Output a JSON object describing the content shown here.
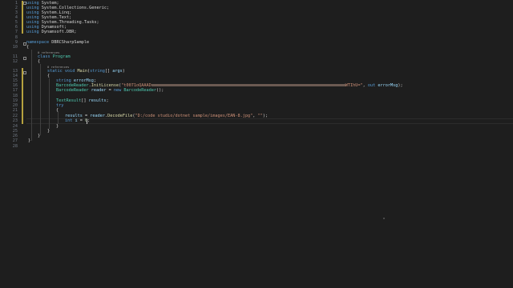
{
  "editor": {
    "line_numbers": [
      "1",
      "2",
      "3",
      "4",
      "5",
      "6",
      "7",
      "8",
      "9",
      "10",
      "11",
      "12",
      "13",
      "14",
      "15",
      "16",
      "17",
      "18",
      "19",
      "20",
      "21",
      "22",
      "23",
      "24",
      "25",
      "26",
      "27",
      "28"
    ],
    "codelens": {
      "class_refs": "0 references",
      "main_refs": "0 references"
    },
    "lines": {
      "l1": {
        "kw": "using",
        "rest": " System;"
      },
      "l2": {
        "kw": "using",
        "rest": " System.Collections.Generic;"
      },
      "l3": {
        "kw": "using",
        "rest": " System.Linq;"
      },
      "l4": {
        "kw": "using",
        "rest": " System.Text;"
      },
      "l5": {
        "kw": "using",
        "rest": " System.Threading.Tasks;"
      },
      "l6": {
        "kw": "using",
        "rest": " Dynamsoft;"
      },
      "l7": {
        "kw": "using",
        "rest": " Dynamsoft.DBR;"
      },
      "l9": {
        "kw": "namespace",
        "name": "DBRCSharpSample"
      },
      "l10": {
        "text": "{"
      },
      "l11": {
        "kw": "class",
        "name": "Program"
      },
      "l12": {
        "text": "{"
      },
      "l13": {
        "kw1": "static",
        "kw2": "void",
        "fn": "Main",
        "open": "(",
        "kw3": "string",
        "rest": "[] ",
        "var": "args",
        "close": ")"
      },
      "l14": {
        "text": "{"
      },
      "l15": {
        "kw": "string",
        "var": "errorMsg",
        "end": ";"
      },
      "l16": {
        "ty": "BarcodeReader",
        "dot": ".",
        "fn": "InitLicense",
        "open": "(",
        "str1": "\"t0071oQAAAD",
        "str2": "WTIhU=\"",
        "sep": ", ",
        "kw": "out",
        "var": "errorMsg",
        "end": ");"
      },
      "l17": {
        "ty": "BarcodeReader",
        "var": "reader",
        "eq": " = ",
        "kw": "new",
        "ty2": "BarcodeReader",
        "end": "();"
      },
      "l19": {
        "ty": "TextResult",
        "rest": "[] ",
        "var": "results",
        "end": ";"
      },
      "l20": {
        "kw": "try"
      },
      "l21": {
        "text": "{"
      },
      "l22": {
        "var": "results",
        "eq": " = ",
        "var2": "reader",
        "dot": ".",
        "fn": "DecodeFile",
        "open": "(",
        "str": "\"D:/code studio/dotnet sample/images/EAN-8.jpg\"",
        "sep": ", ",
        "str2": "\"\"",
        "end": ");"
      },
      "l23": {
        "kw": "int",
        "var": "i",
        "eq": " = ",
        "num": "0",
        "end": ";"
      },
      "l24": {
        "text": "}"
      },
      "l25": {
        "text": "}"
      },
      "l26": {
        "text": "}"
      },
      "l27": {
        "text": "}"
      }
    }
  }
}
